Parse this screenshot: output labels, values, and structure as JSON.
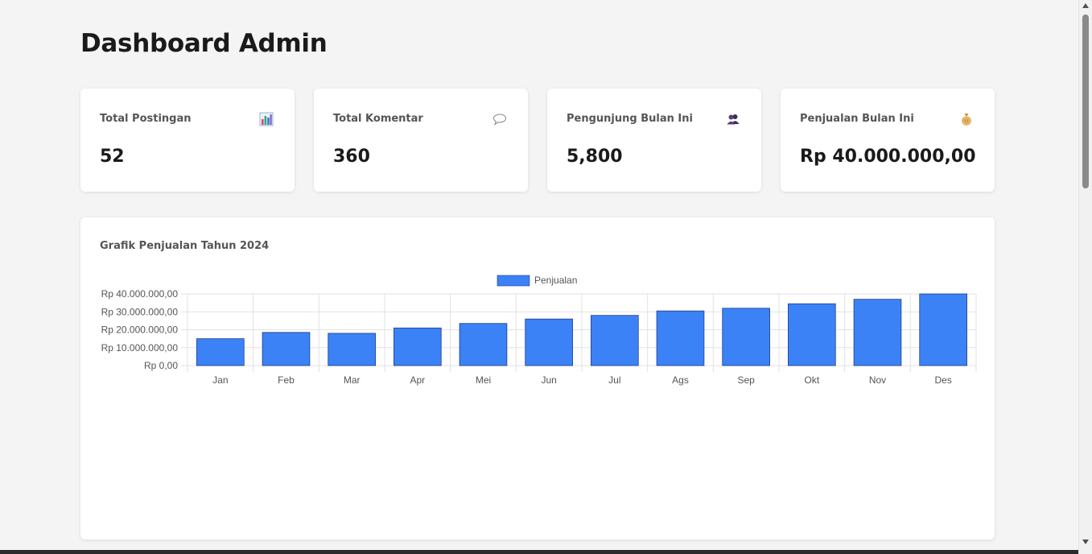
{
  "page": {
    "title": "Dashboard Admin"
  },
  "stats": [
    {
      "label": "Total Postingan",
      "value": "52",
      "icon": "bar-chart-icon"
    },
    {
      "label": "Total Komentar",
      "value": "360",
      "icon": "speech-bubble-icon"
    },
    {
      "label": "Pengunjung Bulan Ini",
      "value": "5,800",
      "icon": "people-icon"
    },
    {
      "label": "Penjualan Bulan Ini",
      "value": "Rp 40.000.000,00",
      "icon": "money-bag-icon"
    }
  ],
  "chart_section": {
    "title": "Grafik Penjualan Tahun 2024"
  },
  "colors": {
    "bar": "#3b82f6",
    "bar_border": "#1e3a8a",
    "background": "#f4f4f4",
    "card": "#ffffff"
  },
  "chart_data": {
    "type": "bar",
    "title": "Grafik Penjualan Tahun 2024",
    "categories": [
      "Jan",
      "Feb",
      "Mar",
      "Apr",
      "Mei",
      "Jun",
      "Jul",
      "Ags",
      "Sep",
      "Okt",
      "Nov",
      "Des"
    ],
    "series": [
      {
        "name": "Penjualan",
        "values": [
          15000000,
          18500000,
          18000000,
          21000000,
          23500000,
          26000000,
          28000000,
          30500000,
          32000000,
          34500000,
          37000000,
          40000000
        ]
      }
    ],
    "ylim": [
      0,
      40000000
    ],
    "yticks": [
      0,
      10000000,
      20000000,
      30000000,
      40000000
    ],
    "ytick_labels": [
      "Rp 0,00",
      "Rp 10.000.000,00",
      "Rp 20.000.000,00",
      "Rp 30.000.000,00",
      "Rp 40.000.000,00"
    ],
    "legend": "top-center",
    "grid": true
  }
}
